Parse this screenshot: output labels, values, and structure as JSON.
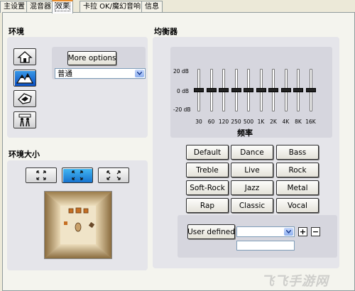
{
  "tabs": [
    {
      "label": "主设置",
      "active": false
    },
    {
      "label": "混音器",
      "active": false
    },
    {
      "label": "效果",
      "active": true
    },
    {
      "label": "卡拉 OK/魔幻音响",
      "active": false
    },
    {
      "label": "信息",
      "active": false
    }
  ],
  "environment": {
    "title": "环境",
    "more_options_label": "More options",
    "select_value": "普通",
    "icons": [
      {
        "name": "house-icon",
        "selected": false
      },
      {
        "name": "mountains-icon",
        "selected": true
      },
      {
        "name": "shape-icon",
        "selected": false
      },
      {
        "name": "people-icon",
        "selected": false
      }
    ]
  },
  "environment_size": {
    "title": "环境大小",
    "options": [
      {
        "name": "size-small",
        "selected": false
      },
      {
        "name": "size-medium",
        "selected": true
      },
      {
        "name": "size-large",
        "selected": false
      }
    ]
  },
  "equalizer": {
    "title": "均衡器",
    "db_labels": [
      "20 dB",
      "0 dB",
      "-20 dB"
    ],
    "axis_label": "频率",
    "bands": [
      {
        "freq": "30",
        "gain_db": 0
      },
      {
        "freq": "60",
        "gain_db": 0
      },
      {
        "freq": "120",
        "gain_db": 0
      },
      {
        "freq": "250",
        "gain_db": 0
      },
      {
        "freq": "500",
        "gain_db": 0
      },
      {
        "freq": "1K",
        "gain_db": 0
      },
      {
        "freq": "2K",
        "gain_db": 0
      },
      {
        "freq": "4K",
        "gain_db": 0
      },
      {
        "freq": "8K",
        "gain_db": 0
      },
      {
        "freq": "16K",
        "gain_db": 0
      }
    ],
    "presets": [
      "Default",
      "Dance",
      "Bass",
      "Treble",
      "Live",
      "Rock",
      "Soft-Rock",
      "Jazz",
      "Metal",
      "Rap",
      "Classic",
      "Vocal"
    ],
    "user_defined_label": "User defined",
    "user_select_value": "",
    "plus_label": "+",
    "minus_label": "−",
    "name_input_value": ""
  },
  "watermark": "飞飞手游网",
  "colors": {
    "selected_blue": "#0a4fc4",
    "tab_highlight": "#e68b2c",
    "window_bg": "#ece9d8"
  }
}
